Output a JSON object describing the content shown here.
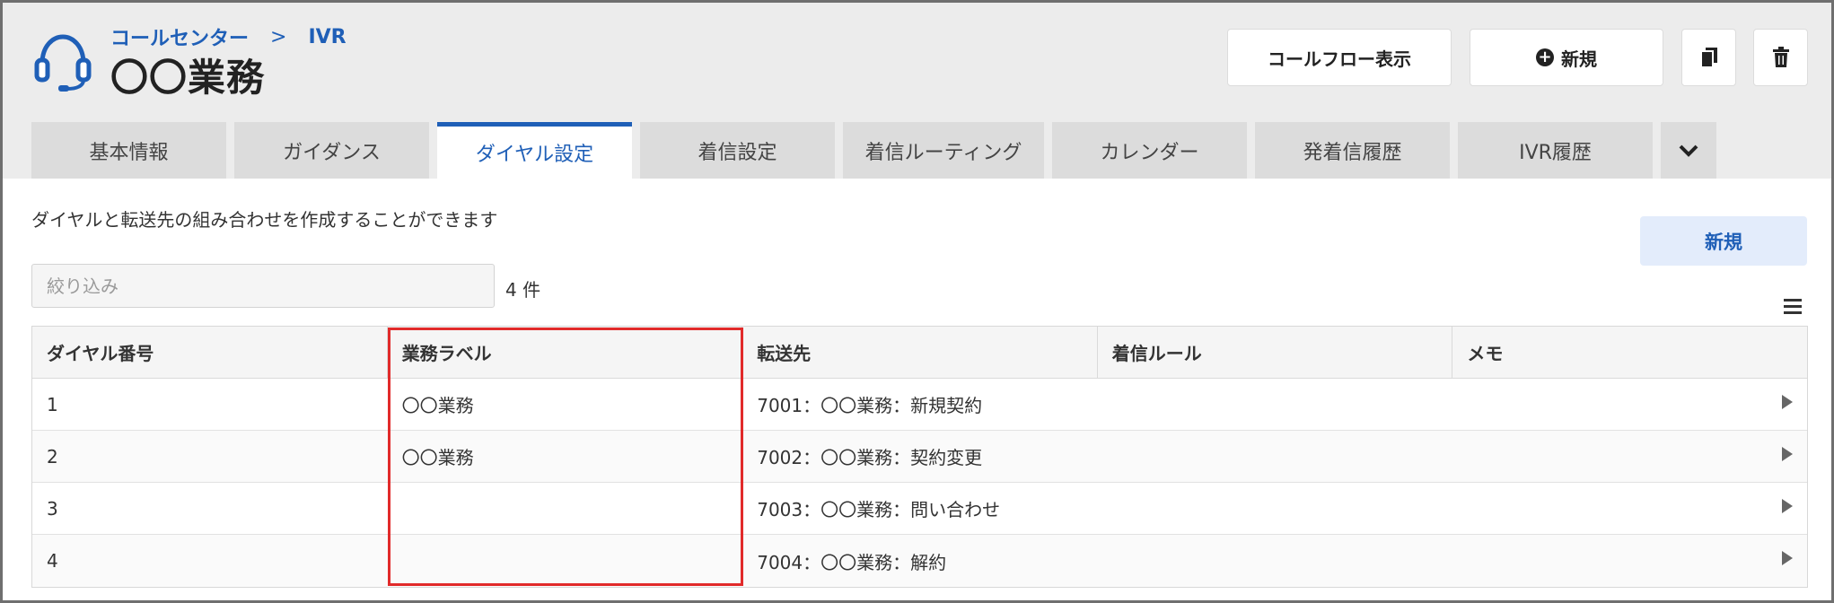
{
  "breadcrumb": {
    "parent": "コールセンター",
    "separator": ">",
    "current": "IVR"
  },
  "page_title": "〇〇業務",
  "header_buttons": {
    "call_flow": "コールフロー表示",
    "new": "新規"
  },
  "tabs": [
    {
      "label": "基本情報"
    },
    {
      "label": "ガイダンス"
    },
    {
      "label": "ダイヤル設定",
      "active": true
    },
    {
      "label": "着信設定"
    },
    {
      "label": "着信ルーティング"
    },
    {
      "label": "カレンダー"
    },
    {
      "label": "発着信履歴"
    },
    {
      "label": "IVR履歴"
    }
  ],
  "description": "ダイヤルと転送先の組み合わせを作成することができます",
  "new_button": "新規",
  "filter": {
    "placeholder": "絞り込み",
    "value": ""
  },
  "count": "4 件",
  "table": {
    "headers": [
      "ダイヤル番号",
      "業務ラベル",
      "転送先",
      "着信ルール",
      "メモ"
    ],
    "rows": [
      {
        "dial": "1",
        "label": "〇〇業務",
        "dest": "7001：〇〇業務：新規契約"
      },
      {
        "dial": "2",
        "label": "〇〇業務",
        "dest": "7002：〇〇業務：契約変更"
      },
      {
        "dial": "3",
        "label": "",
        "dest": "7003：〇〇業務：問い合わせ"
      },
      {
        "dial": "4",
        "label": "",
        "dest": "7004：〇〇業務：解約"
      }
    ]
  },
  "colors": {
    "accent": "#1f5fb7",
    "highlight": "#e12a2a",
    "header_bg": "#ececec"
  },
  "icons": [
    "headset-icon",
    "plus-circle-icon",
    "copy-icon",
    "trash-icon",
    "chevron-down-icon",
    "menu-icon",
    "row-arrow-icon"
  ]
}
